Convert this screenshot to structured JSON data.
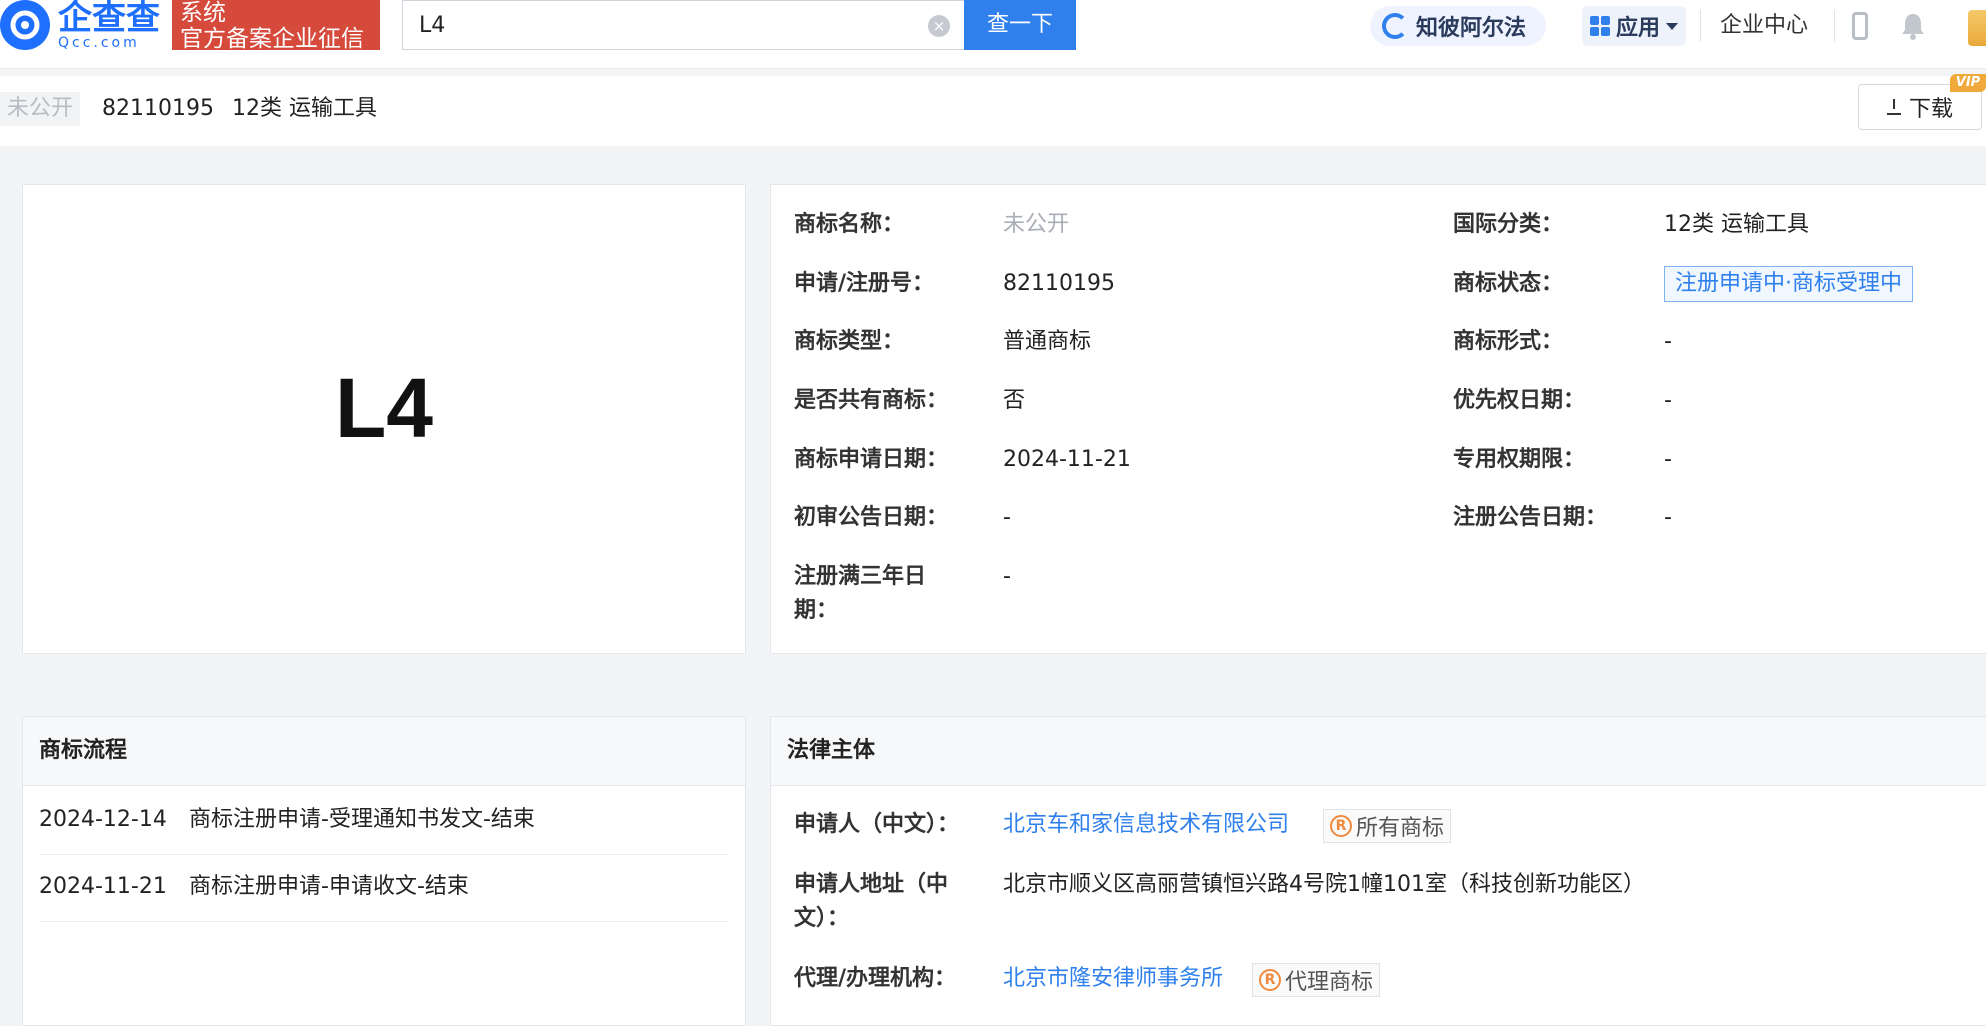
{
  "header": {
    "logo_cn": "企查查",
    "logo_en": "Qcc.com",
    "badge_line1": "系统",
    "badge_line2": "官方备案企业征信",
    "search": {
      "value": "L4",
      "button_label": "查一下"
    },
    "zhibi_label": "知彼阿尔法",
    "apps_label": "应用",
    "enterprise_center": "企业中心"
  },
  "subheader": {
    "name_tag": "未公开",
    "reg_number": "82110195",
    "class_label": "12类 运输工具",
    "download_label": "下载",
    "vip_label": "VIP"
  },
  "trademark": {
    "image_text": "L4"
  },
  "details": {
    "left": [
      {
        "label": "商标名称：",
        "value": "未公开"
      },
      {
        "label": "申请/注册号：",
        "value": "82110195"
      },
      {
        "label": "商标类型：",
        "value": "普通商标"
      },
      {
        "label": "是否共有商标：",
        "value": "否"
      },
      {
        "label": "商标申请日期：",
        "value": "2024-11-21"
      },
      {
        "label": "初审公告日期：",
        "value": "-"
      },
      {
        "label_line1": "注册满三年日",
        "label_line2": "期：",
        "value": "-"
      }
    ],
    "right": [
      {
        "label": "国际分类：",
        "value": "12类 运输工具"
      },
      {
        "label": "商标状态：",
        "value": "注册申请中·商标受理中"
      },
      {
        "label": "商标形式：",
        "value": "-"
      },
      {
        "label": "优先权日期：",
        "value": "-"
      },
      {
        "label": "专用权期限：",
        "value": "-"
      },
      {
        "label": "注册公告日期：",
        "value": "-"
      }
    ]
  },
  "flow": {
    "title": "商标流程",
    "items": [
      {
        "date": "2024-12-14",
        "text": "商标注册申请-受理通知书发文-结束"
      },
      {
        "date": "2024-11-21",
        "text": "商标注册申请-申请收文-结束"
      }
    ]
  },
  "legal": {
    "title": "法律主体",
    "applicant_label": "申请人（中文）：",
    "applicant_value": "北京车和家信息技术有限公司",
    "applicant_tag": "所有商标",
    "address_label_line1": "申请人地址（中",
    "address_label_line2": "文）：",
    "address_value": "北京市顺义区高丽营镇恒兴路4号院1幢101室（科技创新功能区）",
    "agent_label": "代理/办理机构：",
    "agent_value": "北京市隆安律师事务所",
    "agent_tag": "代理商标"
  },
  "colors": {
    "accent": "#2f80ed",
    "brand_red": "#d54a3b",
    "tag_orange": "#f08a3c"
  }
}
